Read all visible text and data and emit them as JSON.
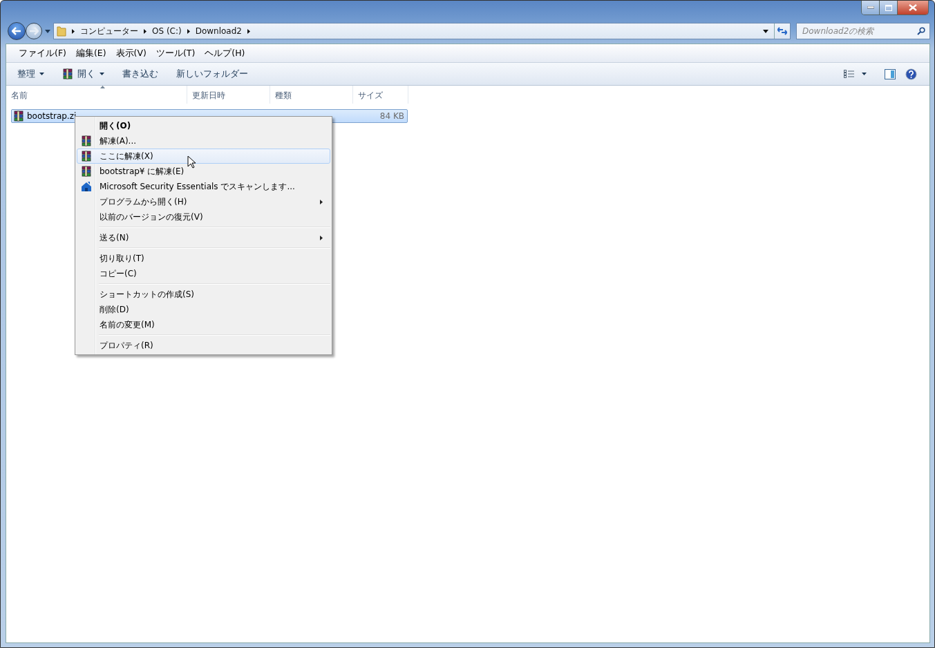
{
  "address_bar": {
    "crumbs": [
      "コンピューター",
      "OS (C:)",
      "Download2"
    ]
  },
  "search": {
    "placeholder": "Download2の検索"
  },
  "menu_bar": [
    "ファイル(F)",
    "編集(E)",
    "表示(V)",
    "ツール(T)",
    "ヘルプ(H)"
  ],
  "toolbar": [
    {
      "label": "整理",
      "kind": "menu"
    },
    {
      "label": "開く",
      "kind": "archive"
    },
    {
      "label": "書き込む",
      "kind": "button"
    },
    {
      "label": "新しいフォルダー",
      "kind": "button"
    }
  ],
  "table": {
    "columns": [
      "名前",
      "更新日時",
      "種類",
      "サイズ"
    ],
    "rows": [
      {
        "name": "bootstrap.zi",
        "size": "84 KB",
        "selected": true
      }
    ]
  },
  "context_menu": [
    {
      "kind": "item",
      "label": "開く(O)",
      "default": true,
      "submenu": false,
      "selected": false
    },
    {
      "kind": "archive",
      "label": "解凍(A)...",
      "default": false,
      "submenu": false,
      "selected": false
    },
    {
      "kind": "archive",
      "label": "ここに解凍(X)",
      "default": false,
      "submenu": false,
      "selected": true
    },
    {
      "kind": "archive",
      "label": "bootstrap¥ に解凍(E)",
      "default": false,
      "submenu": false,
      "selected": false
    },
    {
      "kind": "security",
      "label": "Microsoft Security Essentials でスキャンします...",
      "default": false,
      "submenu": false,
      "selected": false
    },
    {
      "kind": "item",
      "label": "プログラムから開く(H)",
      "default": false,
      "submenu": true,
      "selected": false
    },
    {
      "kind": "item",
      "label": "以前のバージョンの復元(V)",
      "default": false,
      "submenu": false,
      "selected": false
    },
    {
      "kind": "separator"
    },
    {
      "kind": "item",
      "label": "送る(N)",
      "default": false,
      "submenu": true,
      "selected": false
    },
    {
      "kind": "separator"
    },
    {
      "kind": "item",
      "label": "切り取り(T)",
      "default": false,
      "submenu": false,
      "selected": false
    },
    {
      "kind": "item",
      "label": "コピー(C)",
      "default": false,
      "submenu": false,
      "selected": false
    },
    {
      "kind": "separator"
    },
    {
      "kind": "item",
      "label": "ショートカットの作成(S)",
      "default": false,
      "submenu": false,
      "selected": false
    },
    {
      "kind": "item",
      "label": "削除(D)",
      "default": false,
      "submenu": false,
      "selected": false
    },
    {
      "kind": "item",
      "label": "名前の変更(M)",
      "default": false,
      "submenu": false,
      "selected": false
    },
    {
      "kind": "separator"
    },
    {
      "kind": "item",
      "label": "プロパティ(R)",
      "default": false,
      "submenu": false,
      "selected": false
    }
  ]
}
